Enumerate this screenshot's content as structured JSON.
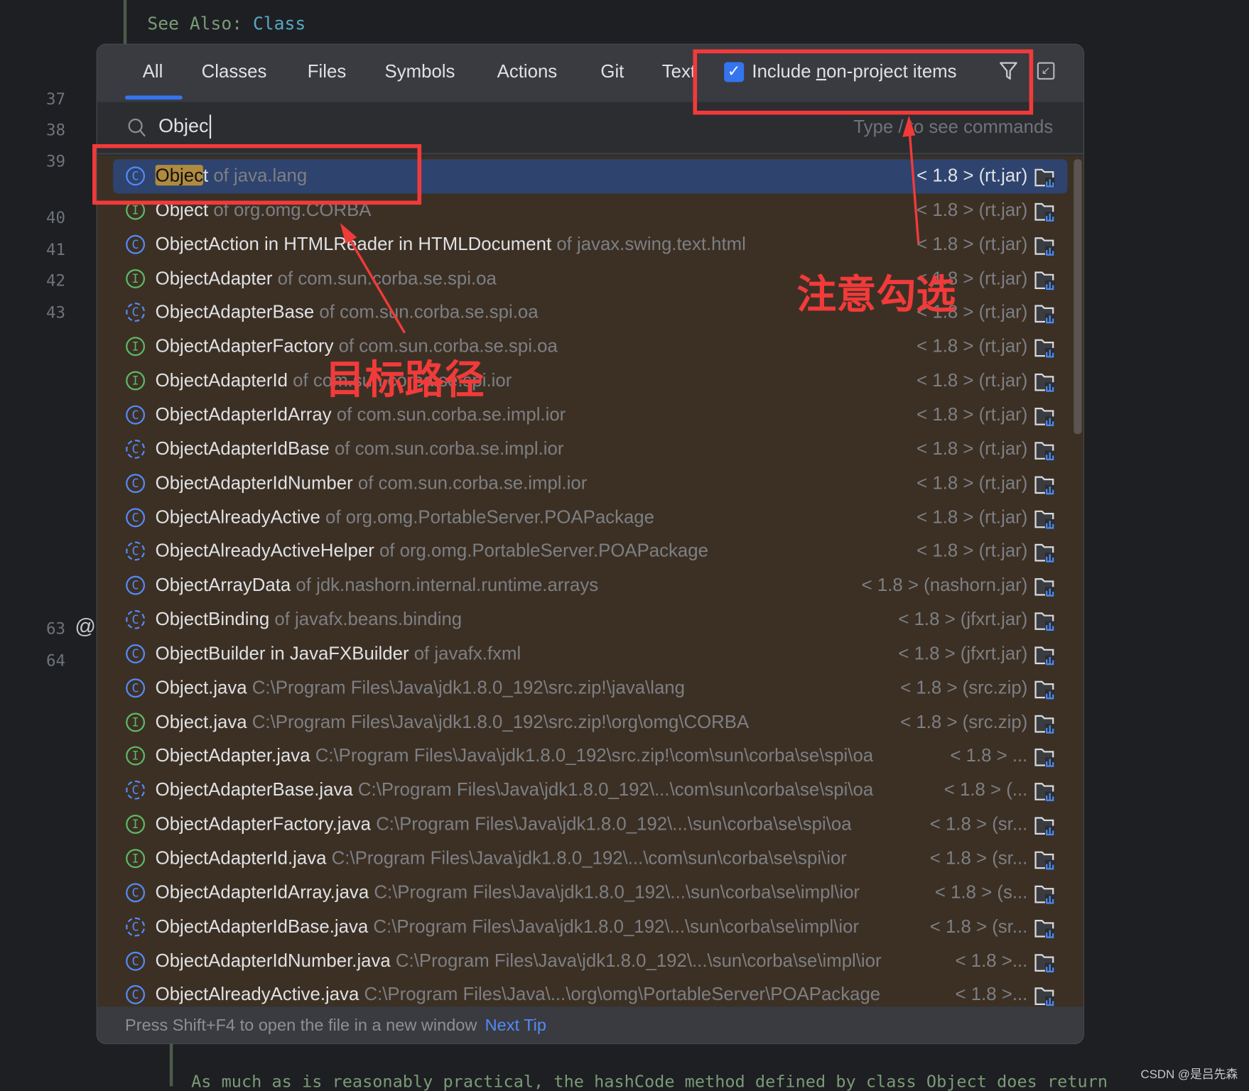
{
  "editor": {
    "line_numbers": [
      "37",
      "38",
      "39",
      "40",
      "41",
      "42",
      "43",
      "63",
      "64"
    ],
    "doc_see_also_label": "See Also:",
    "doc_see_also_link": "Class",
    "doc_bottom_text": "As much as is reasonably practical, the hashCode method defined by class Object does return",
    "gutter_icon": "at-sign-icon"
  },
  "popup": {
    "tabs": [
      "All",
      "Classes",
      "Files",
      "Symbols",
      "Actions",
      "Git",
      "Text"
    ],
    "active_tab": "All",
    "include_non_project": {
      "checked": true,
      "label_pre": "Include ",
      "label_ul": "n",
      "label_post": "on-project items"
    },
    "search": {
      "value": "Objec",
      "hint": "Type / to see commands"
    },
    "results": [
      {
        "icon": "class",
        "name": "Object",
        "detail": "of java.lang",
        "loc": "< 1.8 > (rt.jar)",
        "selected": true
      },
      {
        "icon": "interface",
        "name": "Object",
        "detail": "of org.omg.CORBA",
        "loc": "< 1.8 > (rt.jar)"
      },
      {
        "icon": "class",
        "name": "ObjectAction in HTMLReader in HTMLDocument",
        "detail": "of javax.swing.text.html",
        "loc": "< 1.8 > (rt.jar)"
      },
      {
        "icon": "interface",
        "name": "ObjectAdapter",
        "detail": "of com.sun.corba.se.spi.oa",
        "loc": "< 1.8 > (rt.jar)"
      },
      {
        "icon": "abstract-class",
        "name": "ObjectAdapterBase",
        "detail": "of com.sun.corba.se.spi.oa",
        "loc": "< 1.8 > (rt.jar)"
      },
      {
        "icon": "interface",
        "name": "ObjectAdapterFactory",
        "detail": "of com.sun.corba.se.spi.oa",
        "loc": "< 1.8 > (rt.jar)"
      },
      {
        "icon": "interface",
        "name": "ObjectAdapterId",
        "detail": "of com.sun.corba.se.spi.ior",
        "loc": "< 1.8 > (rt.jar)"
      },
      {
        "icon": "class",
        "name": "ObjectAdapterIdArray",
        "detail": "of com.sun.corba.se.impl.ior",
        "loc": "< 1.8 > (rt.jar)"
      },
      {
        "icon": "abstract-class",
        "name": "ObjectAdapterIdBase",
        "detail": "of com.sun.corba.se.impl.ior",
        "loc": "< 1.8 > (rt.jar)"
      },
      {
        "icon": "class",
        "name": "ObjectAdapterIdNumber",
        "detail": "of com.sun.corba.se.impl.ior",
        "loc": "< 1.8 > (rt.jar)"
      },
      {
        "icon": "class",
        "name": "ObjectAlreadyActive",
        "detail": "of org.omg.PortableServer.POAPackage",
        "loc": "< 1.8 > (rt.jar)"
      },
      {
        "icon": "abstract-class",
        "name": "ObjectAlreadyActiveHelper",
        "detail": "of org.omg.PortableServer.POAPackage",
        "loc": "< 1.8 > (rt.jar)"
      },
      {
        "icon": "class",
        "name": "ObjectArrayData",
        "detail": "of jdk.nashorn.internal.runtime.arrays",
        "loc": "< 1.8 > (nashorn.jar)"
      },
      {
        "icon": "abstract-class",
        "name": "ObjectBinding",
        "detail": "of javafx.beans.binding",
        "loc": "< 1.8 > (jfxrt.jar)"
      },
      {
        "icon": "class",
        "name": "ObjectBuilder in JavaFXBuilder",
        "detail": "of javafx.fxml",
        "loc": "< 1.8 > (jfxrt.jar)"
      },
      {
        "icon": "class",
        "name": "Object.java",
        "detail": "C:\\Program Files\\Java\\jdk1.8.0_192\\src.zip!\\java\\lang",
        "loc": "< 1.8 > (src.zip)"
      },
      {
        "icon": "interface",
        "name": "Object.java",
        "detail": "C:\\Program Files\\Java\\jdk1.8.0_192\\src.zip!\\org\\omg\\CORBA",
        "loc": "< 1.8 > (src.zip)"
      },
      {
        "icon": "interface",
        "name": "ObjectAdapter.java",
        "detail": "C:\\Program Files\\Java\\jdk1.8.0_192\\src.zip!\\com\\sun\\corba\\se\\spi\\oa",
        "loc": "< 1.8 > ..."
      },
      {
        "icon": "abstract-class",
        "name": "ObjectAdapterBase.java",
        "detail": "C:\\Program Files\\Java\\jdk1.8.0_192\\...\\com\\sun\\corba\\se\\spi\\oa",
        "loc": "< 1.8 > (..."
      },
      {
        "icon": "interface",
        "name": "ObjectAdapterFactory.java",
        "detail": "C:\\Program Files\\Java\\jdk1.8.0_192\\...\\sun\\corba\\se\\spi\\oa",
        "loc": "< 1.8 > (sr..."
      },
      {
        "icon": "interface",
        "name": "ObjectAdapterId.java",
        "detail": "C:\\Program Files\\Java\\jdk1.8.0_192\\...\\com\\sun\\corba\\se\\spi\\ior",
        "loc": "< 1.8 > (sr..."
      },
      {
        "icon": "class",
        "name": "ObjectAdapterIdArray.java",
        "detail": "C:\\Program Files\\Java\\jdk1.8.0_192\\...\\sun\\corba\\se\\impl\\ior",
        "loc": "< 1.8 > (s..."
      },
      {
        "icon": "abstract-class",
        "name": "ObjectAdapterIdBase.java",
        "detail": "C:\\Program Files\\Java\\jdk1.8.0_192\\...\\sun\\corba\\se\\impl\\ior",
        "loc": "< 1.8 > (sr..."
      },
      {
        "icon": "class",
        "name": "ObjectAdapterIdNumber.java",
        "detail": "C:\\Program Files\\Java\\jdk1.8.0_192\\...\\sun\\corba\\se\\impl\\ior",
        "loc": "< 1.8 >..."
      },
      {
        "icon": "class",
        "name": "ObjectAlreadyActive.java",
        "detail": "C:\\Program Files\\Java\\...\\org\\omg\\PortableServer\\POAPackage",
        "loc": "< 1.8 >..."
      }
    ],
    "footer": {
      "tip": "Press Shift+F4 to open the file in a new window",
      "next_tip": "Next Tip"
    }
  },
  "annotations": {
    "note_checkbox": "注意勾选",
    "note_target": "目标路径",
    "color": "#f23a3a"
  },
  "watermark": "CSDN @是吕先森"
}
